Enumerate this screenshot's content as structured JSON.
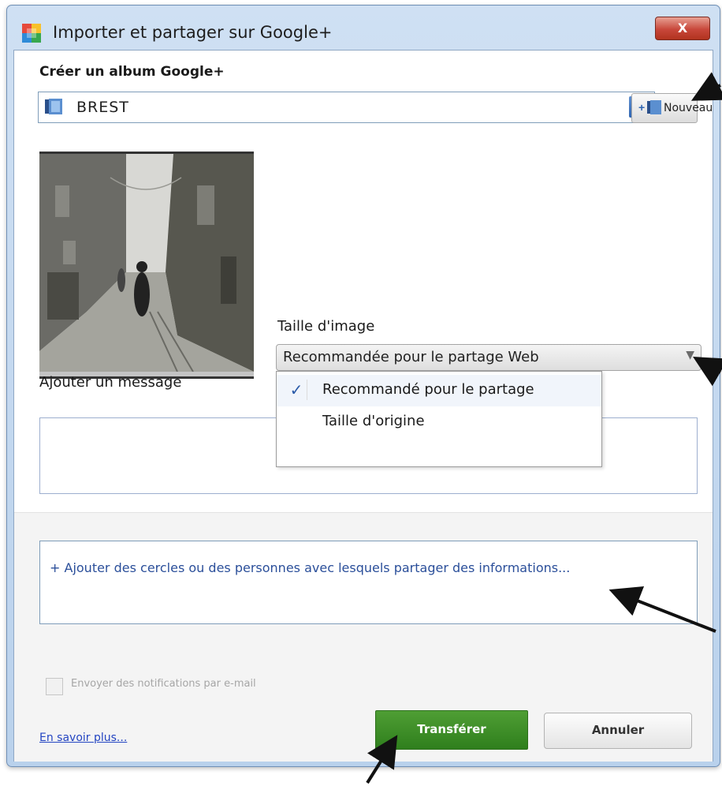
{
  "window": {
    "title": "Importer et partager sur Google+",
    "close_label": "X"
  },
  "album": {
    "section_label": "Créer un album Google+",
    "selected": "BREST",
    "new_button_label": "Nouveau"
  },
  "image_size": {
    "label": "Taille d'image",
    "selected": "Recommandée pour le partage Web",
    "options": [
      {
        "label": "Recommandé pour le partage",
        "checked": true
      },
      {
        "label": "Taille d'origine",
        "checked": false
      }
    ]
  },
  "message": {
    "label": "Ajouter un message",
    "value": ""
  },
  "share": {
    "link_text": "+ Ajouter des cercles ou des personnes avec lesquels partager des informations..."
  },
  "notify": {
    "label": "Envoyer des notifications par e-mail",
    "checked": false
  },
  "footer": {
    "learn_more": "En savoir plus...",
    "transfer_label": "Transférer",
    "cancel_label": "Annuler"
  },
  "colors": {
    "transfer_button": "#3a8a25",
    "close_button": "#c8473a",
    "link": "#2b4f9a",
    "window_frame": "#b9d1ec"
  },
  "icons": [
    "google-photos-icon",
    "album-icon",
    "chevron-down-icon",
    "add-album-icon",
    "check-icon"
  ]
}
